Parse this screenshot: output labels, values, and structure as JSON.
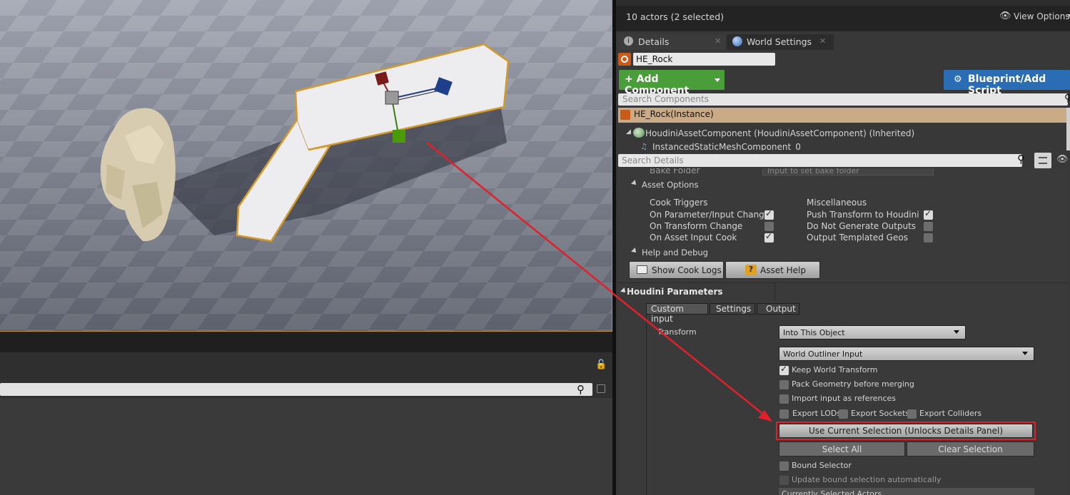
{
  "outliner": {
    "status": "10 actors (2 selected)",
    "view_options": "View Options"
  },
  "tabs": [
    {
      "label": "Details"
    },
    {
      "label": "World Settings"
    }
  ],
  "details": {
    "actor_name": "HE_Rock",
    "add_component": "Add Component",
    "blueprint": "Blueprint/Add Script",
    "search_components_placeholder": "Search Components",
    "instance_row": "HE_Rock(Instance)",
    "component_row": "HoudiniAssetComponent (HoudiniAssetComponent) (Inherited)",
    "instanced_row": "InstancedStaticMeshComponent_0",
    "search_details_placeholder": "Search Details",
    "bake_folder_label": "Bake Folder",
    "bake_folder_placeholder": "Input to set bake folder"
  },
  "asset_options": {
    "header": "Asset Options",
    "cook_triggers": "Cook Triggers",
    "miscellaneous": "Miscellaneous",
    "left": [
      {
        "label": "On Parameter/Input Change",
        "checked": true
      },
      {
        "label": "On Transform Change",
        "checked": false
      },
      {
        "label": "On Asset Input Cook",
        "checked": true
      }
    ],
    "right": [
      {
        "label": "Push Transform to Houdini",
        "checked": true
      },
      {
        "label": "Do Not Generate Outputs",
        "checked": false
      },
      {
        "label": "Output Templated Geos",
        "checked": false
      }
    ]
  },
  "help_debug": {
    "header": "Help and Debug",
    "show_cook_logs": "Show Cook Logs",
    "asset_help": "Asset Help"
  },
  "houdini_params": {
    "header": "Houdini Parameters",
    "subtabs": [
      "Custom input",
      "Settings",
      "Output"
    ],
    "transform_label": "Transform",
    "transform_value": "Into This Object",
    "input_type": "World Outliner Input",
    "keep_world_transform": "Keep World Transform",
    "pack_geometry": "Pack Geometry before merging",
    "import_refs": "Import input as references",
    "export_lods": "Export LODs",
    "export_sockets": "Export Sockets",
    "export_colliders": "Export Colliders",
    "use_current_selection": "Use Current Selection (Unlocks Details Panel)",
    "select_all": "Select All",
    "clear_selection": "Clear Selection",
    "bound_selector": "Bound Selector",
    "update_bound": "Update bound selection automatically",
    "currently_selected": "Currently Selected Actors"
  },
  "colors": {
    "accent_green": "#4a9e3a",
    "accent_blue": "#2a6db4",
    "selection_orange": "#d39a2a",
    "highlight_red": "#e0202a",
    "instance_row_bg": "#c9ab87"
  }
}
